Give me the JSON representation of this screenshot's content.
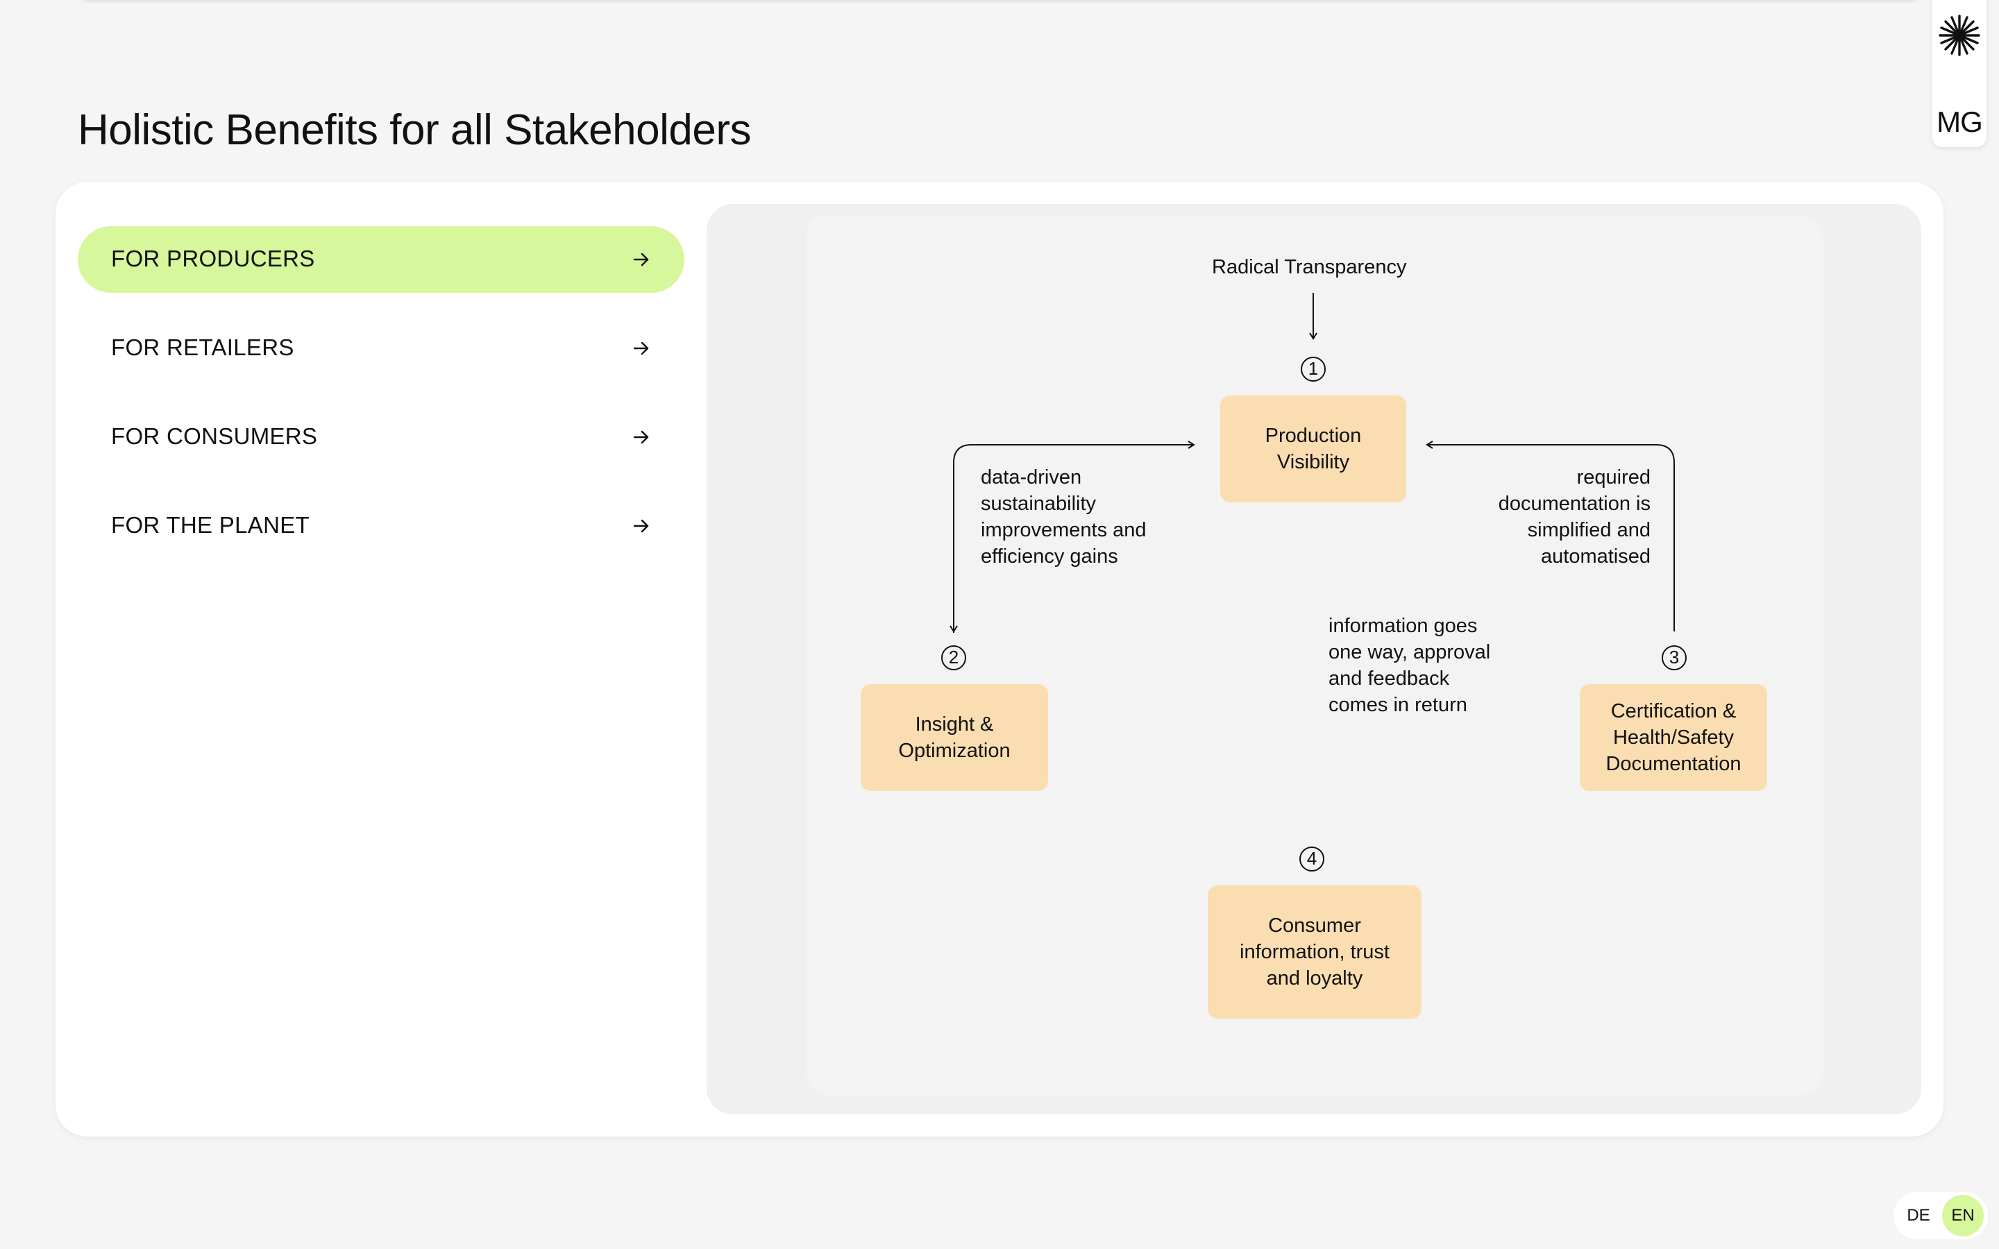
{
  "brand": {
    "initials": "MG",
    "logo_icon": "starburst-icon"
  },
  "page": {
    "title": "Holistic Benefits for all Stakeholders"
  },
  "tabs": [
    {
      "label": "FOR PRODUCERS",
      "active": true,
      "icon": "arrow-right-icon"
    },
    {
      "label": "FOR RETAILERS",
      "active": false,
      "icon": "arrow-right-icon"
    },
    {
      "label": "FOR CONSUMERS",
      "active": false,
      "icon": "arrow-right-icon"
    },
    {
      "label": "FOR THE PLANET",
      "active": false,
      "icon": "arrow-right-icon"
    }
  ],
  "diagram": {
    "top_label": "Radical Transparency",
    "nodes": [
      {
        "number": "1",
        "label": "Production\nVisibility"
      },
      {
        "number": "2",
        "label": "Insight &\nOptimization"
      },
      {
        "number": "3",
        "label": "Certification &\nHealth/Safety\nDocumentation"
      },
      {
        "number": "4",
        "label": "Consumer\ninformation, trust\nand loyalty"
      }
    ],
    "annotations": {
      "left": "data-driven\nsustainability\nimprovements and\nefficiency gains",
      "right": "required\ndocumentation is\nsimplified and\nautomatised",
      "center": "information goes\none way, approval\nand feedback\ncomes in return"
    }
  },
  "language": {
    "options": [
      "DE",
      "EN"
    ],
    "selected": "EN"
  },
  "colors": {
    "accent_green": "#d7f79c",
    "node_fill": "#fadeb2",
    "background": "#f5f5f5"
  }
}
